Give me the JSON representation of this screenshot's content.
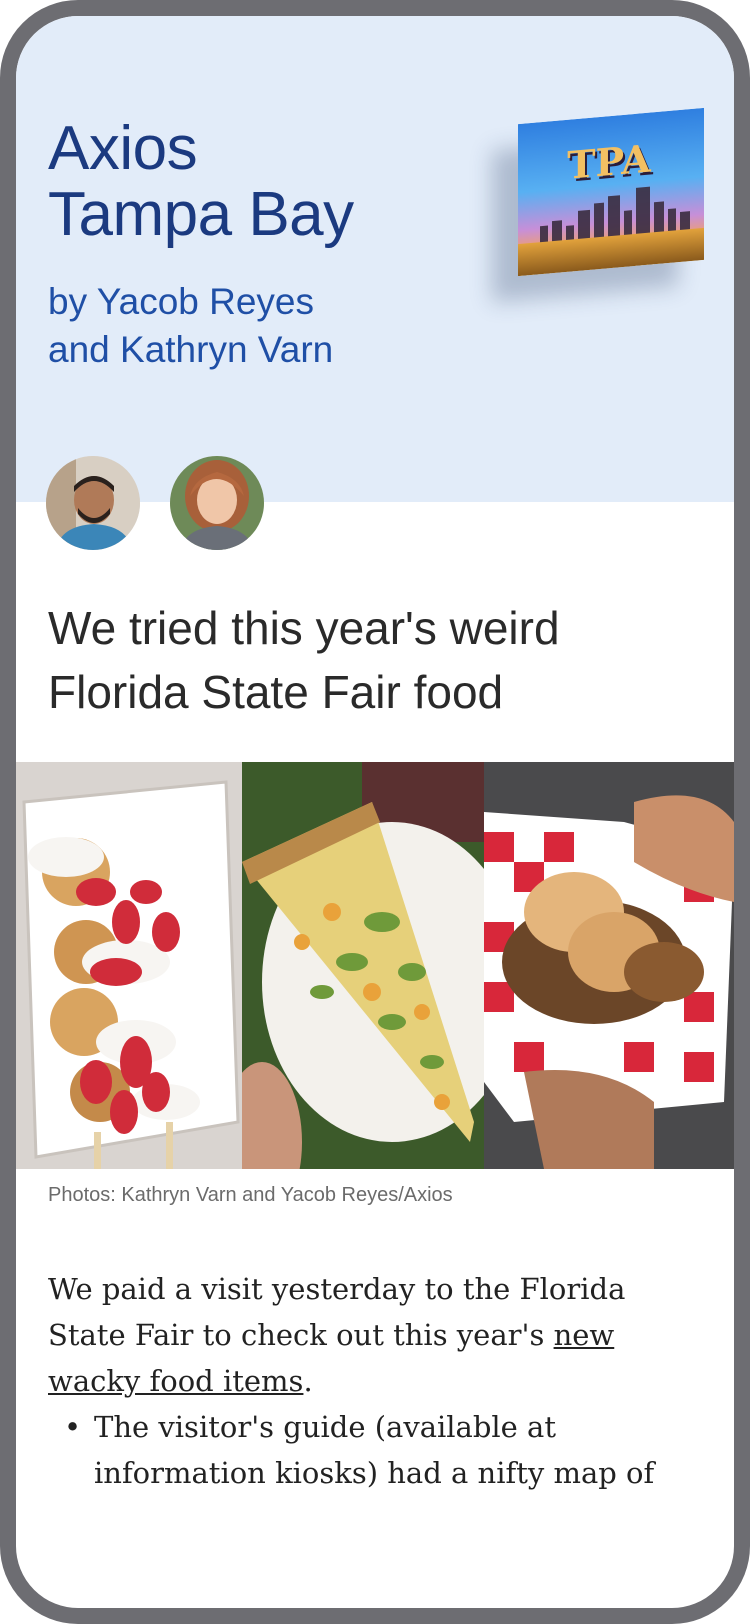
{
  "header": {
    "title_line1": "Axios",
    "title_line2": "Tampa Bay",
    "byline_line1": "by Yacob Reyes",
    "byline_line2": "and Kathryn Varn",
    "postcard_text": "TPA"
  },
  "article": {
    "headline": "We tried this year's weird Florida State Fair food",
    "photo_caption": "Photos: Kathryn Varn and Yacob Reyes/Axios",
    "para_text_before": "We paid a visit yesterday to the Florida State Fair to check out this year's ",
    "para_link": "new wacky food items",
    "para_text_after": ".",
    "bullet_text": "The visitor's guide (available at information kiosks) had a nifty map of"
  },
  "colors": {
    "header_background": "#e2ecf9",
    "brand_blue": "#1b3a80",
    "byline_blue": "#1f4fa6",
    "frame_gray": "#6d6d72"
  },
  "icons": {
    "bullet": "•"
  }
}
